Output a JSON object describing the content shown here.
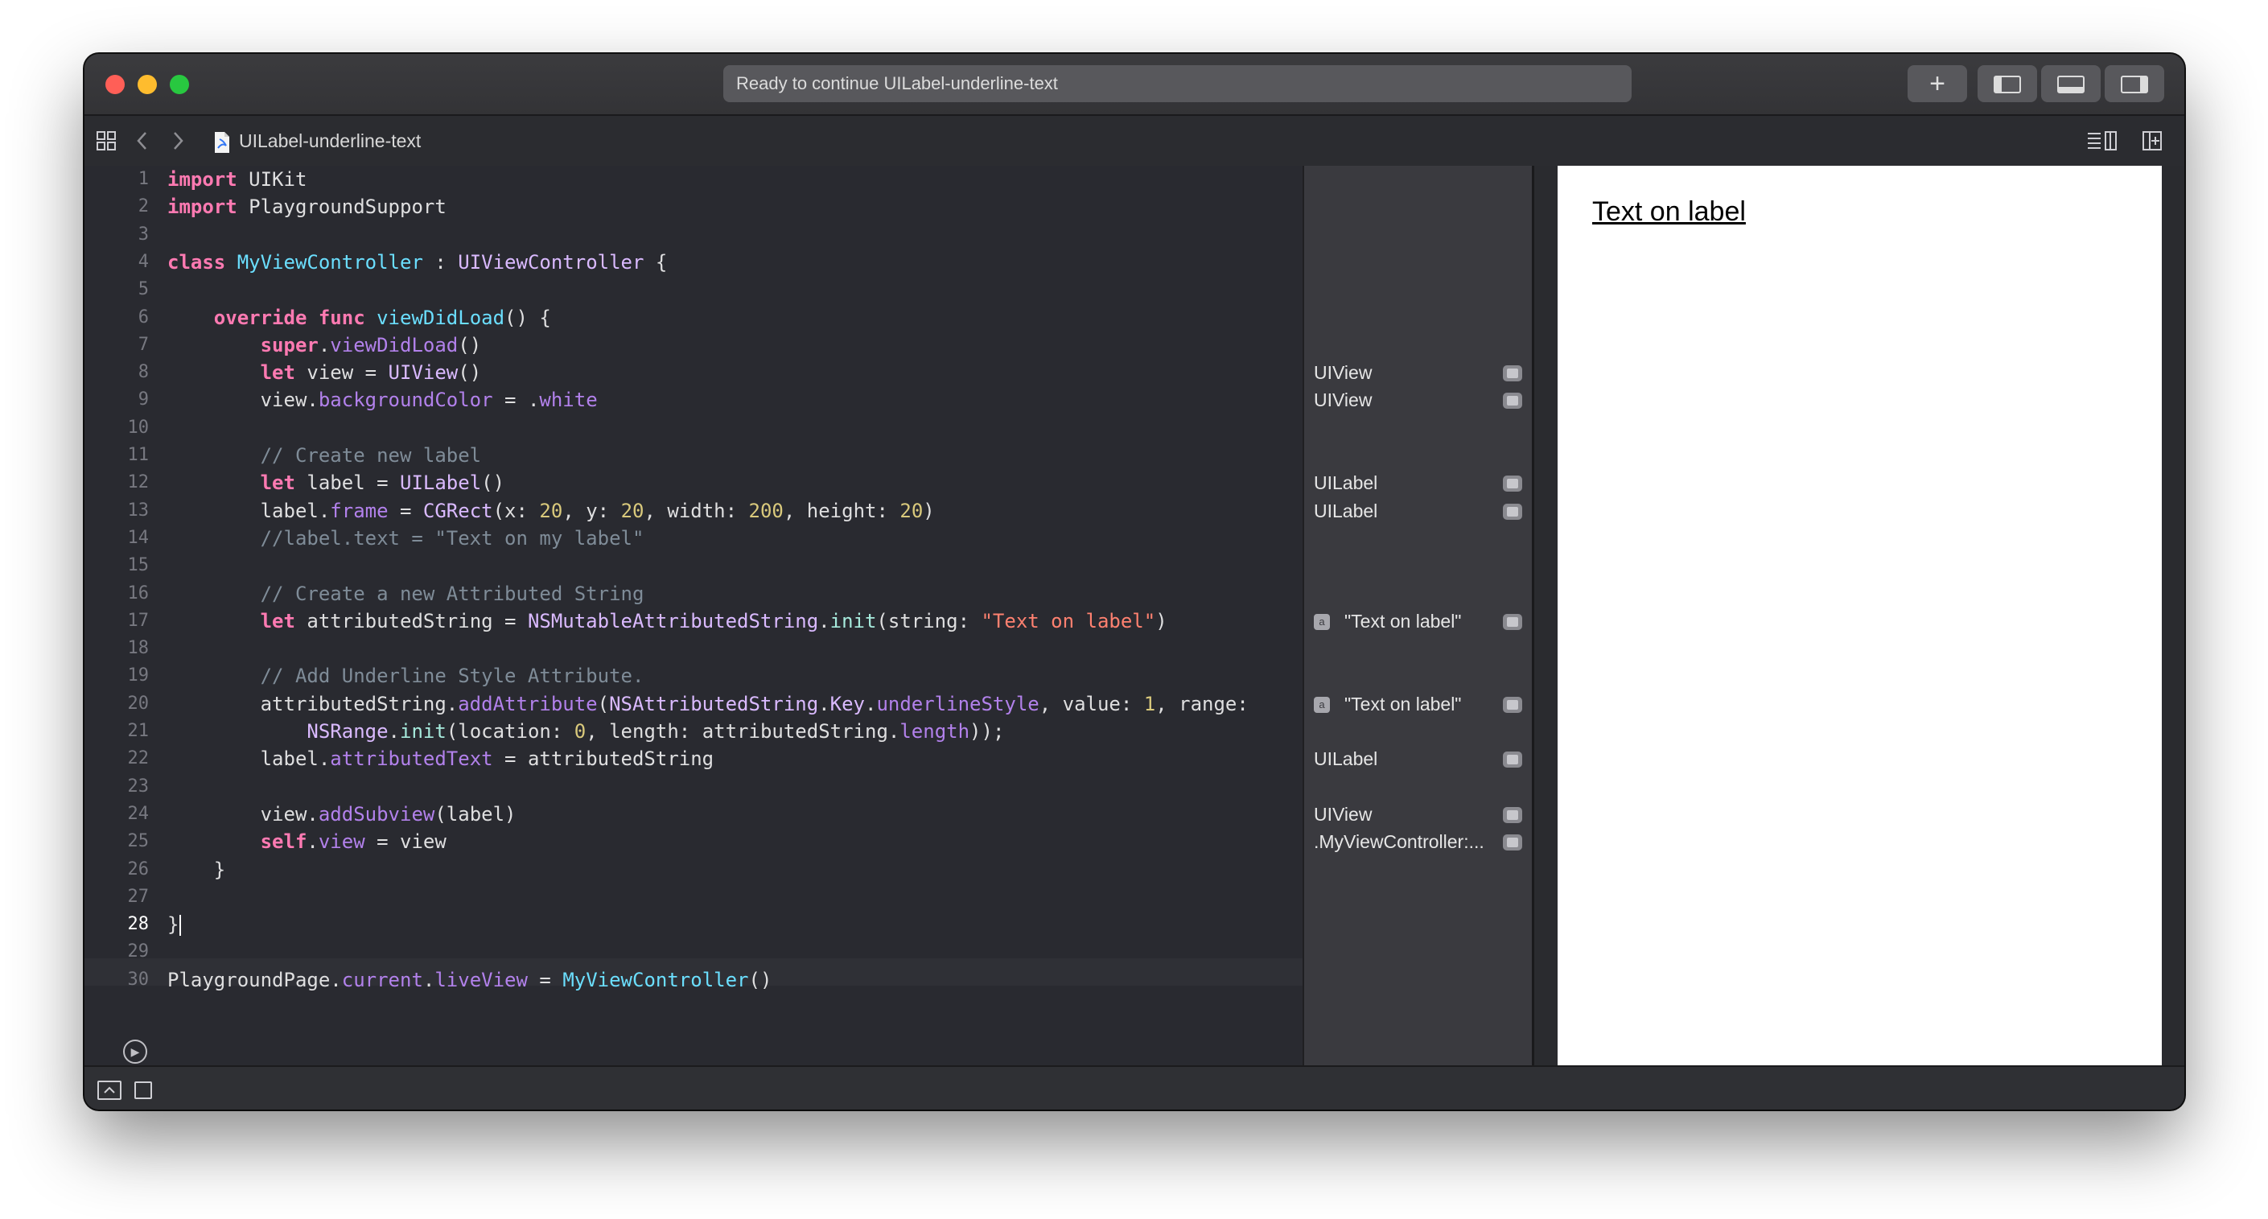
{
  "window": {
    "status_text": "Ready to continue UILabel-underline-text",
    "add_button": "+",
    "panel_buttons": [
      "left-panel-icon",
      "bottom-panel-icon",
      "right-panel-icon"
    ]
  },
  "jumpbar": {
    "file_name": "UILabel-underline-text",
    "icons": [
      "grid-icon",
      "back-chevron-icon",
      "forward-chevron-icon",
      "swift-file-icon",
      "editor-options-icon",
      "add-editor-icon"
    ]
  },
  "editor": {
    "active_line": "28",
    "line_numbers": [
      "1",
      "2",
      "3",
      "4",
      "5",
      "6",
      "7",
      "8",
      "9",
      "10",
      "11",
      "12",
      "13",
      "14",
      "15",
      "16",
      "17",
      "18",
      "19",
      "20",
      "21",
      "22",
      "23",
      "24",
      "25",
      "26",
      "27",
      "28",
      "29",
      "30"
    ],
    "tokens": {
      "import": "import",
      "uikit": "UIKit",
      "playground_support": "PlaygroundSupport",
      "class": "class",
      "my_vc": "MyViewController",
      "colon": " : ",
      "uivc": "UIViewController",
      "open_brace": " {",
      "override": "override",
      "func": "func",
      "view_did_load": "viewDidLoad",
      "parens_brace": "() {",
      "super": "super",
      "dot": ".",
      "call_parens": "()",
      "let": "let",
      "view_var": " view = ",
      "uiview": "UIView",
      "view": "view",
      "background_color": "backgroundColor",
      "eq": " = .",
      "white": "white",
      "comment_create_label": "// Create new label",
      "label_var": " label = ",
      "uilabel": "UILabel",
      "label": "label",
      "frame": "frame",
      "assign": " = ",
      "cgrect": "CGRect",
      "x_arg": "(x: ",
      "n20": "20",
      "y_arg": ", y: ",
      "width_arg": ", width: ",
      "n200": "200",
      "height_arg": ", height: ",
      "close_paren": ")",
      "comment_label_text": "//label.text = \"Text on my label\"",
      "comment_create_attr": "// Create a new Attributed String",
      "attr_var": " attributedString = ",
      "nsmas": "NSMutableAttributedString",
      "init": "init",
      "string_arg": "(string: ",
      "text_on_label": "\"Text on label\"",
      "comment_add_underline": "// Add Underline Style Attribute.",
      "attributed_string": "attributedString",
      "add_attribute": "addAttribute",
      "open_paren": "(",
      "nsas": "NSAttributedString",
      "key": "Key",
      "underline_style": "underlineStyle",
      "value_arg": ", value: ",
      "n1": "1",
      "range_arg": ", range:",
      "nsrange": "NSRange",
      "location_arg": "(location: ",
      "n0": "0",
      "length_arg": ", length: ",
      "length": "length",
      "end_call": "));",
      "attributed_text": "attributedText",
      "attr_rhs": " = attributedString",
      "add_subview": "addSubview",
      "label_arg": "(label)",
      "self": "self",
      "view_rhs": " = view",
      "close_brace": "}",
      "playground_page": "PlaygroundPage",
      "current": "current",
      "live_view": "liveView",
      "my_vc_call": "MyViewController",
      "indent1": "    ",
      "indent2": "        ",
      "indent3": "            "
    }
  },
  "results": [
    {
      "line": 8,
      "text": "UIView",
      "icon": false
    },
    {
      "line": 9,
      "text": "UIView",
      "icon": false
    },
    {
      "line": 12,
      "text": "UILabel",
      "icon": false
    },
    {
      "line": 13,
      "text": "UILabel",
      "icon": false
    },
    {
      "line": 17,
      "text": "\"Text on label\"",
      "icon": true
    },
    {
      "line": 20,
      "text": "\"Text on label\"",
      "icon": true
    },
    {
      "line": 22,
      "text": "UILabel",
      "icon": false
    },
    {
      "line": 24,
      "text": "UIView",
      "icon": false
    },
    {
      "line": 25,
      "text": ".MyViewController:...",
      "icon": false
    }
  ],
  "results_icon_glyph": "a",
  "live_view": {
    "label_text": "Text on label",
    "background": "#ffffff"
  },
  "colors": {
    "keyword": "#ff7ab2",
    "type": "#dabaff",
    "declared_type": "#6bdfff",
    "property": "#b281eb",
    "number": "#d9c97c",
    "string": "#ff8170",
    "comment": "#7f8c98"
  },
  "run_icon": "play-circle-icon",
  "bottom_icons": [
    "show-debug-area-icon",
    "console-toggle-icon"
  ]
}
